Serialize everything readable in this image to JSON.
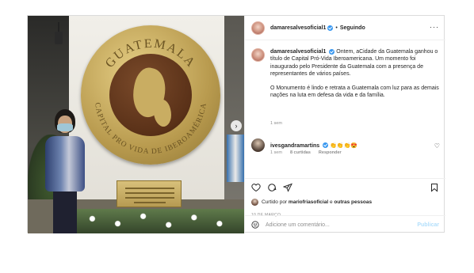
{
  "post": {
    "author": {
      "username": "damaresalvesoficial1",
      "verified": true
    },
    "follow_status": "Seguindo",
    "more_icon": "more-horizontal-icon"
  },
  "photo": {
    "medallion_top": "GUATEMALA",
    "medallion_ring": "CAPITAL PRO VIDA DE IBEROAMÉRICA"
  },
  "caption": {
    "username": "damaresalvesoficial1",
    "paragraph1": "Ontem, aCidade da Guatemala ganhou o título de Capital Pró-Vida Iberoamericana. Um momento foi inaugurado pelo Presidente da Guatemala com a presença de representantes de vários países.",
    "paragraph2": "O Monumento é lindo e retrata a Guatemala com luz para as demais nações na luta em defesa da vida e da família.",
    "time": "1 sem"
  },
  "comments": [
    {
      "username": "ivesgandramartins",
      "verified": true,
      "text": "👏👏👏😍",
      "time": "1 sem",
      "likes": "8 curtidas",
      "reply": "Responder"
    }
  ],
  "actions": {
    "like_icon": "heart-icon",
    "comment_icon": "comment-icon",
    "share_icon": "share-icon",
    "save_icon": "bookmark-icon"
  },
  "likes_summary": {
    "prefix": "Curtido por",
    "user": "mariofriasoficial",
    "connector": "e",
    "others": "outras pessoas"
  },
  "date": "10 DE MARÇO",
  "add_comment": {
    "placeholder": "Adicione um comentário...",
    "publish_label": "Publicar"
  },
  "colors": {
    "verified": "#3897f0",
    "publish_disabled": "#b2dffc",
    "secondary_text": "#8e8e8e"
  }
}
